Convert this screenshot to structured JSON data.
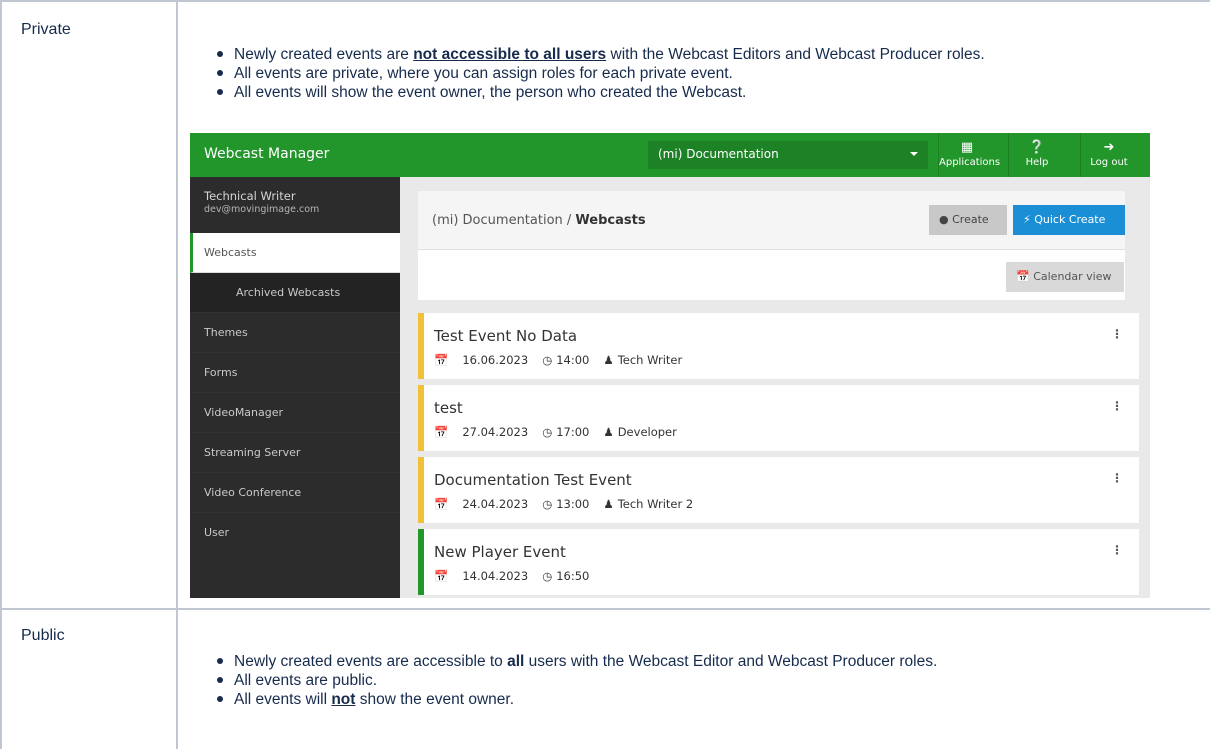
{
  "rows": [
    {
      "label": "Private",
      "bullets": [
        {
          "pre": "Newly created events are ",
          "bold": "not accessible to all users",
          "post": " with the Webcast Editors and Webcast Producer roles."
        },
        {
          "pre": "All events are private, where you can assign roles for each private event.",
          "bold": "",
          "post": ""
        },
        {
          "pre": "All events will show the event owner, the person who created the Webcast.",
          "bold": "",
          "post": ""
        }
      ]
    },
    {
      "label": "Public",
      "bullets": [
        {
          "pre": "Newly created events are accessible to ",
          "bold": "all",
          "post": " users with the Webcast Editor and Webcast Producer roles."
        },
        {
          "pre": "All events are public.",
          "bold": "",
          "post": ""
        },
        {
          "pre": "All events will ",
          "bold": "not",
          "post": " show the event owner."
        }
      ]
    }
  ],
  "app": {
    "brand": "Webcast Manager",
    "selector": "(mi) Documentation",
    "top_buttons": {
      "applications": "Applications",
      "help": "Help",
      "logout": "Log out"
    },
    "user": {
      "name": "Technical Writer",
      "email": "dev@movingimage.com"
    },
    "nav": [
      "Webcasts",
      "Archived Webcasts",
      "Themes",
      "Forms",
      "VideoManager",
      "Streaming Server",
      "Video Conference",
      "User"
    ],
    "breadcrumb": {
      "parent": "(mi) Documentation / ",
      "current": "Webcasts"
    },
    "buttons": {
      "create": "Create",
      "quick_create": "Quick Create",
      "calendar": "Calendar view"
    },
    "events": [
      {
        "title": "Test Event No Data",
        "date": "16.06.2023",
        "time": "14:00",
        "owner": "Tech Writer",
        "status_color": "#f0c23b"
      },
      {
        "title": "test",
        "date": "27.04.2023",
        "time": "17:00",
        "owner": "Developer",
        "status_color": "#f0c23b"
      },
      {
        "title": "Documentation Test Event",
        "date": "24.04.2023",
        "time": "13:00",
        "owner": "Tech Writer 2",
        "status_color": "#f0c23b"
      },
      {
        "title": "New Player Event",
        "date": "14.04.2023",
        "time": "16:50",
        "owner": "",
        "status_color": "#22952b"
      }
    ],
    "icons": {
      "calendar": "calendar-icon",
      "clock": "clock-icon",
      "user": "user-icon",
      "kebab": "kebab-icon"
    }
  }
}
